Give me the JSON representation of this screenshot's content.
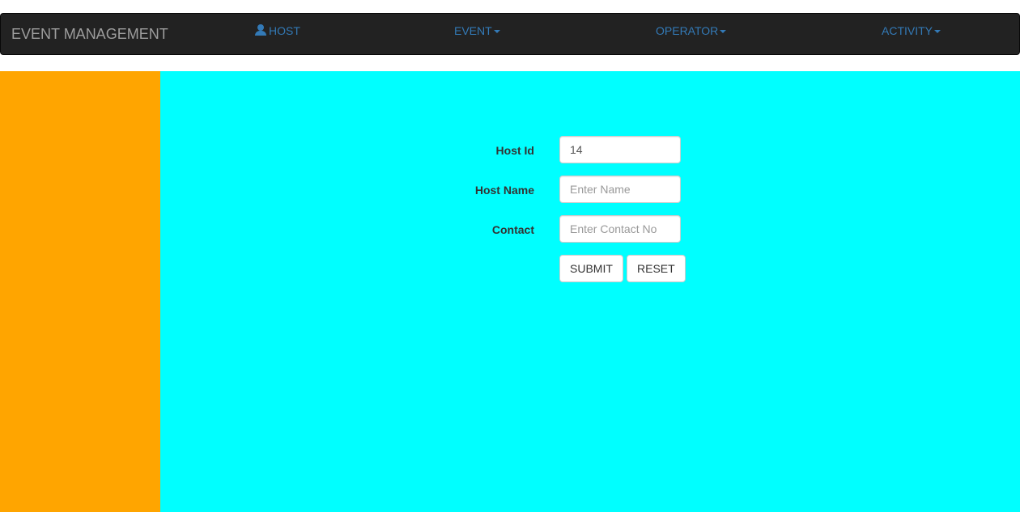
{
  "navbar": {
    "brand": "EVENT MANAGEMENT",
    "items": [
      {
        "label": "HOST",
        "icon": "user-icon",
        "dropdown": false
      },
      {
        "label": "EVENT",
        "dropdown": true
      },
      {
        "label": "OPERATOR",
        "dropdown": true
      },
      {
        "label": "ACTIVITY",
        "dropdown": true
      }
    ]
  },
  "form": {
    "host_id": {
      "label": "Host Id",
      "value": "14"
    },
    "host_name": {
      "label": "Host Name",
      "placeholder": "Enter Name",
      "value": ""
    },
    "contact": {
      "label": "Contact",
      "placeholder": "Enter Contact No",
      "value": ""
    },
    "submit_label": "SUBMIT",
    "reset_label": "RESET"
  },
  "colors": {
    "navbar_bg": "#222222",
    "brand_text": "#9d9d9d",
    "nav_link": "#337ab7",
    "sidebar_bg": "#ffa500",
    "main_bg": "#00ffff"
  }
}
